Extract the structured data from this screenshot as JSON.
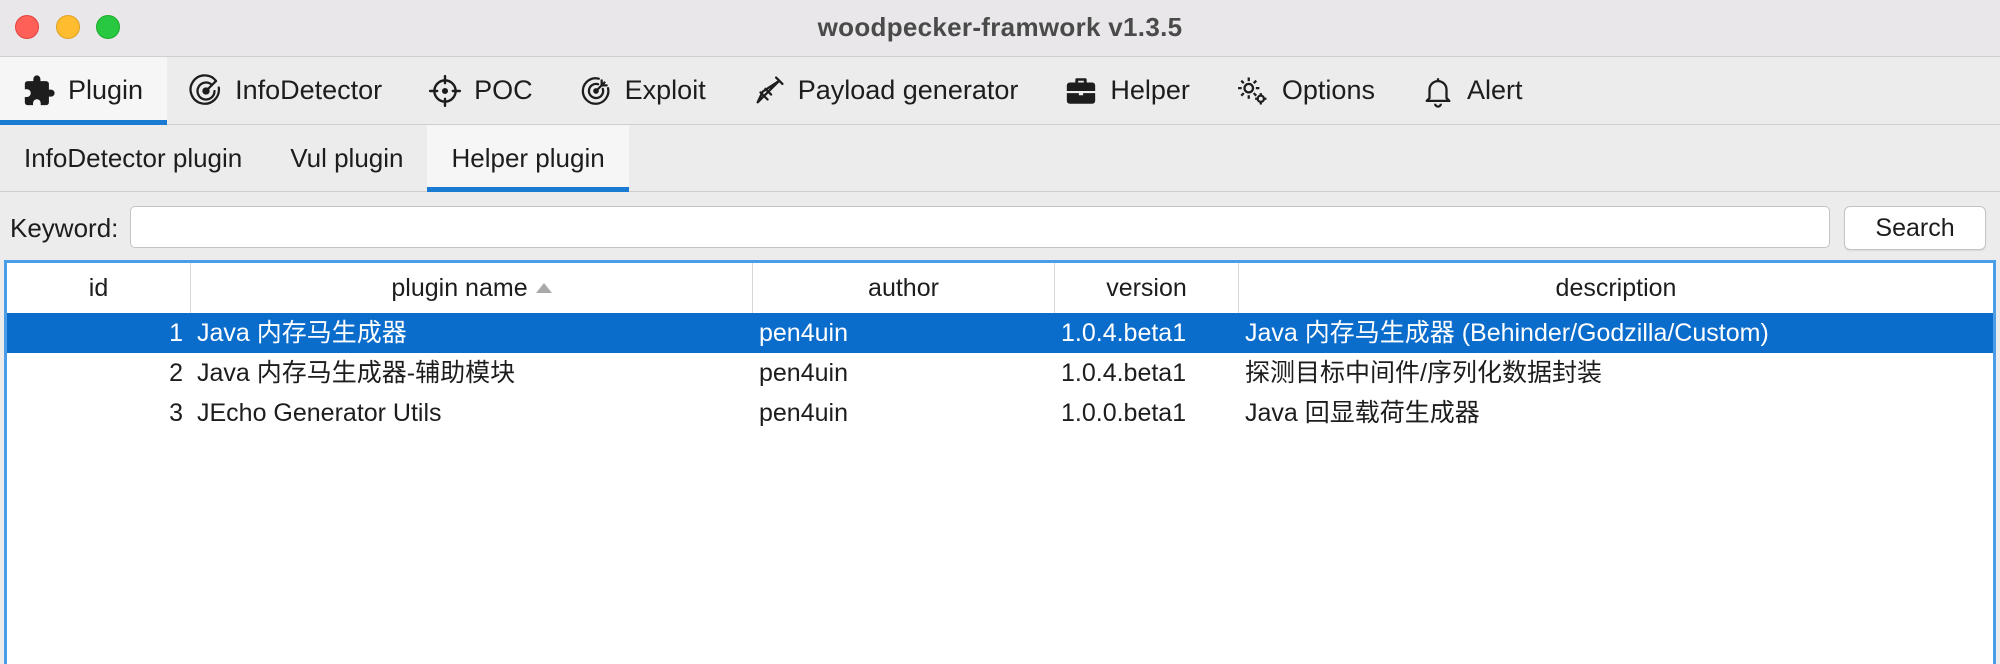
{
  "window": {
    "title": "woodpecker-framwork v1.3.5"
  },
  "main_tabs": [
    {
      "label": "Plugin",
      "icon": "puzzle-icon",
      "active": true
    },
    {
      "label": "InfoDetector",
      "icon": "radar-icon",
      "active": false
    },
    {
      "label": "POC",
      "icon": "crosshair-icon",
      "active": false
    },
    {
      "label": "Exploit",
      "icon": "target-icon",
      "active": false
    },
    {
      "label": "Payload generator",
      "icon": "syringe-icon",
      "active": false
    },
    {
      "label": "Helper",
      "icon": "toolbox-icon",
      "active": false
    },
    {
      "label": "Options",
      "icon": "gears-icon",
      "active": false
    },
    {
      "label": "Alert",
      "icon": "bell-icon",
      "active": false
    }
  ],
  "sub_tabs": [
    {
      "label": "InfoDetector plugin",
      "active": false
    },
    {
      "label": "Vul plugin",
      "active": false
    },
    {
      "label": "Helper plugin",
      "active": true
    }
  ],
  "search": {
    "label": "Keyword:",
    "value": "",
    "button_label": "Search"
  },
  "table": {
    "columns": [
      "id",
      "plugin name",
      "author",
      "version",
      "description"
    ],
    "sorted_column": "plugin name",
    "sort_direction": "ascending",
    "rows": [
      {
        "id": "1",
        "name": "Java 内存马生成器",
        "author": "pen4uin",
        "version": "1.0.4.beta1",
        "description": "Java 内存马生成器 (Behinder/Godzilla/Custom)",
        "selected": true
      },
      {
        "id": "2",
        "name": "Java 内存马生成器-辅助模块",
        "author": "pen4uin",
        "version": "1.0.4.beta1",
        "description": "探测目标中间件/序列化数据封装",
        "selected": false
      },
      {
        "id": "3",
        "name": "JEcho Generator Utils",
        "author": "pen4uin",
        "version": "1.0.0.beta1",
        "description": "Java 回显载荷生成器",
        "selected": false
      }
    ]
  },
  "colors": {
    "accent": "#1a7bd2",
    "selection": "#0a6ccb",
    "table_focus_border": "#4c9de8"
  }
}
